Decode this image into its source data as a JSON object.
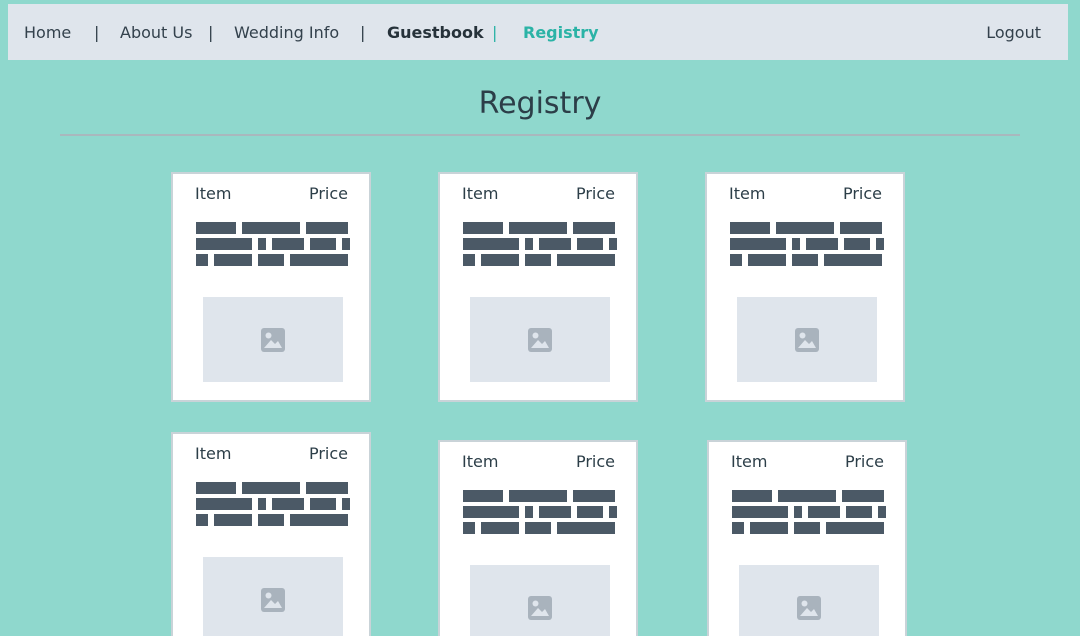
{
  "nav": {
    "items": [
      {
        "label": "Home"
      },
      {
        "label": "About Us"
      },
      {
        "label": "Wedding Info"
      },
      {
        "label": "Guestbook"
      },
      {
        "label": "Registry"
      }
    ],
    "separators": [
      "|",
      "|",
      "|",
      "|"
    ],
    "logout_label": "Logout"
  },
  "page": {
    "title": "Registry"
  },
  "registry": {
    "cards": [
      {
        "item_label": "Item",
        "price_label": "Price",
        "image_icon": "image-icon"
      },
      {
        "item_label": "Item",
        "price_label": "Price",
        "image_icon": "image-icon"
      },
      {
        "item_label": "Item",
        "price_label": "Price",
        "image_icon": "image-icon"
      },
      {
        "item_label": "Item",
        "price_label": "Price",
        "image_icon": "image-icon"
      },
      {
        "item_label": "Item",
        "price_label": "Price",
        "image_icon": "image-icon"
      },
      {
        "item_label": "Item",
        "price_label": "Price",
        "image_icon": "image-icon"
      }
    ]
  },
  "colors": {
    "background": "#8fd8cd",
    "nav_background": "#dfe5ec",
    "accent": "#2bb3a6",
    "text_dark": "#2c3e48",
    "placeholder_block": "#4b5966"
  }
}
